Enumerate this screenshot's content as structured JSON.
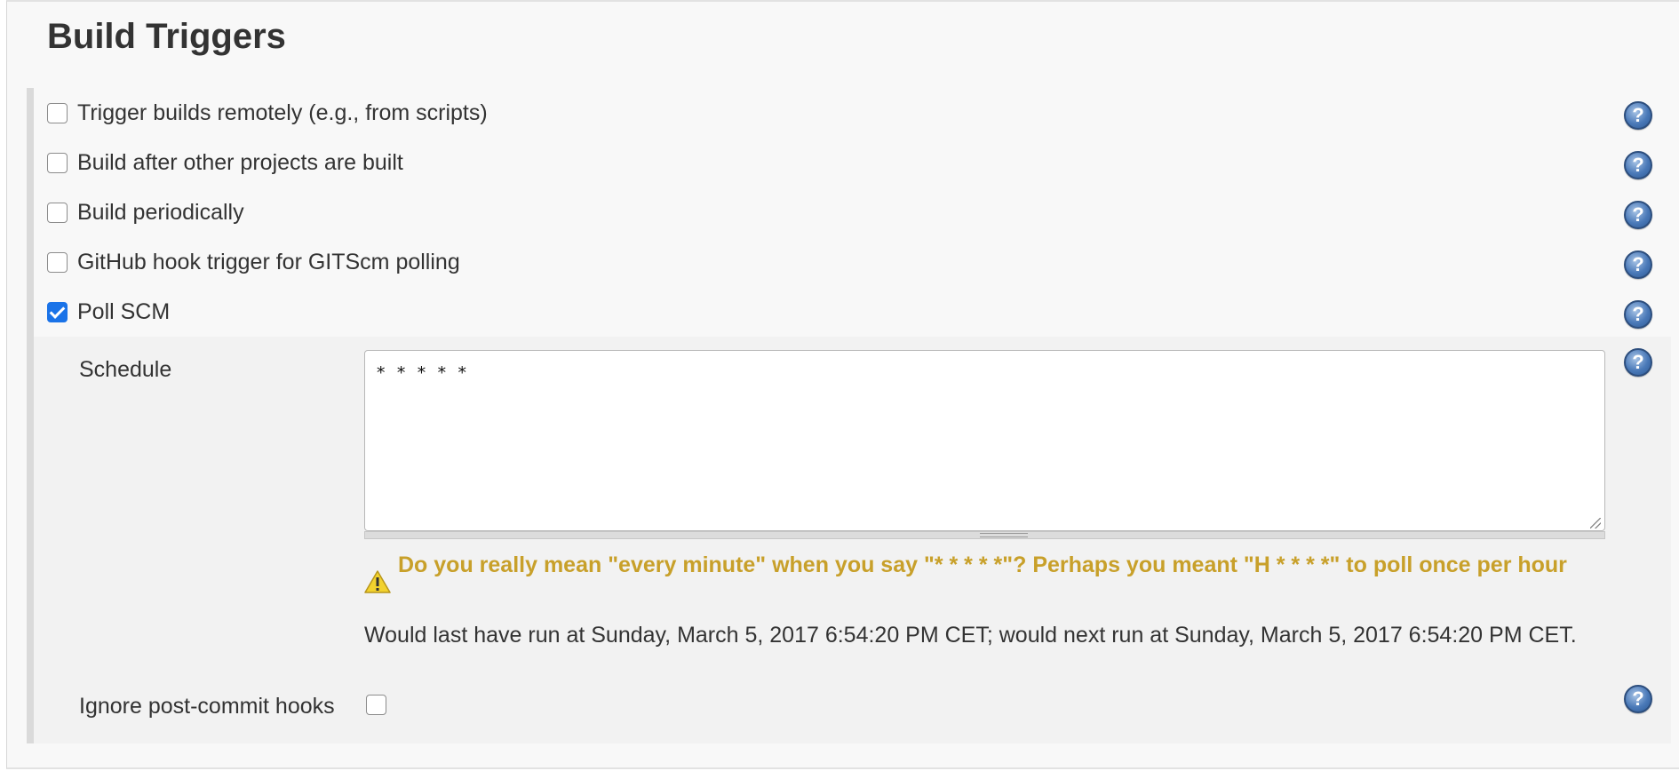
{
  "section": {
    "title": "Build Triggers"
  },
  "triggers": [
    {
      "label": "Trigger builds remotely (e.g., from scripts)",
      "checked": false
    },
    {
      "label": "Build after other projects are built",
      "checked": false
    },
    {
      "label": "Build periodically",
      "checked": false
    },
    {
      "label": "GitHub hook trigger for GITScm polling",
      "checked": false
    },
    {
      "label": "Poll SCM",
      "checked": true
    }
  ],
  "poll_scm": {
    "schedule_label": "Schedule",
    "schedule_value": "* * * * *",
    "warning": "Do you really mean \"every minute\" when you say \"* * * * *\"? Perhaps you meant \"H * * * *\" to poll once per hour",
    "info": "Would last have run at Sunday, March 5, 2017 6:54:20 PM CET; would next run at Sunday, March 5, 2017 6:54:20 PM CET.",
    "ignore_hooks_label": "Ignore post-commit hooks",
    "ignore_hooks_checked": false
  },
  "icons": {
    "help": "help-icon",
    "warning": "warning-icon"
  },
  "colors": {
    "warning_text": "#c8a02a",
    "checkbox_checked": "#1a73e8",
    "help_icon": "#4a79b8"
  }
}
